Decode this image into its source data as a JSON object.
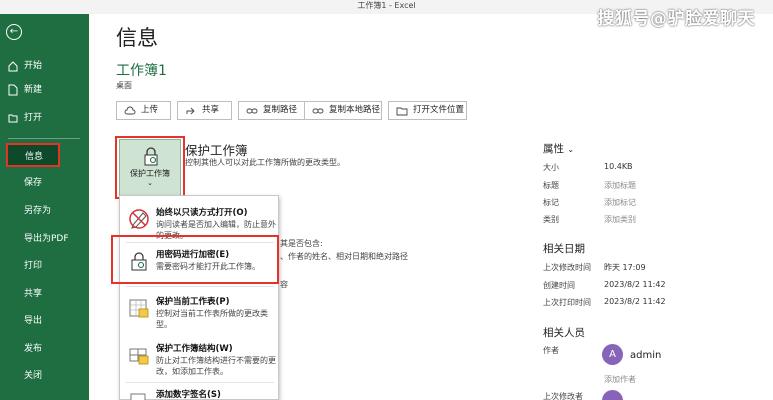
{
  "window": {
    "title": "工作簿1 - Excel",
    "watermark": "搜狐号@驴脸爱聊天"
  },
  "sidebar": {
    "items": [
      {
        "label": "开始"
      },
      {
        "label": "新建"
      },
      {
        "label": "打开"
      },
      {
        "label": "信息"
      },
      {
        "label": "保存"
      },
      {
        "label": "另存为"
      },
      {
        "label": "导出为PDF"
      },
      {
        "label": "打印"
      },
      {
        "label": "共享"
      },
      {
        "label": "导出"
      },
      {
        "label": "发布"
      },
      {
        "label": "关闭"
      }
    ]
  },
  "main": {
    "title": "信息",
    "workbook_name": "工作簿1",
    "location": "桌面",
    "toolbar": [
      "上传",
      "共享",
      "复制路径",
      "复制本地路径",
      "打开文件位置"
    ],
    "protect": {
      "button_label": "保护工作簿",
      "chevron": "⌄",
      "title": "保护工作簿",
      "description": "控制其他人可以对此工作簿所做的更改类型。"
    },
    "fragments": {
      "inspect": "其是否包含:",
      "inspect_detail": "、作者的姓名、相对日期和绝对路径",
      "other": "容"
    },
    "dropdown": [
      {
        "title": "始终以只读方式打开(O)",
        "desc": "询问读者是否加入编辑，防止意外的更改。"
      },
      {
        "title": "用密码进行加密(E)",
        "desc": "需要密码才能打开此工作簿。"
      },
      {
        "title": "保护当前工作表(P)",
        "desc": "控制对当前工作表所做的更改类型。"
      },
      {
        "title": "保护工作簿结构(W)",
        "desc": "防止对工作簿结构进行不需要的更改，如添加工作表。"
      },
      {
        "title": "添加数字签名(S)",
        "desc": ""
      }
    ]
  },
  "properties": {
    "header": "属性",
    "chevron": "⌄",
    "rows": [
      {
        "key": "大小",
        "value": "10.4KB"
      },
      {
        "key": "标题",
        "value": "添加标题"
      },
      {
        "key": "标记",
        "value": "添加标记"
      },
      {
        "key": "类别",
        "value": "添加类别"
      }
    ],
    "dates_header": "相关日期",
    "dates": [
      {
        "key": "上次修改时间",
        "value": "昨天 17:09"
      },
      {
        "key": "创建时间",
        "value": "2023/8/2 11:42"
      },
      {
        "key": "上次打印时间",
        "value": "2023/8/2 11:42"
      }
    ],
    "people_header": "相关人员",
    "author_label": "作者",
    "author_initial": "A",
    "author_name": "admin",
    "add_author": "添加作者",
    "last_modified_by": "上次修改者"
  },
  "colors": {
    "sidebar": "#1e6e42",
    "accent_red": "#e5332a",
    "avatar": "#8764b8"
  }
}
